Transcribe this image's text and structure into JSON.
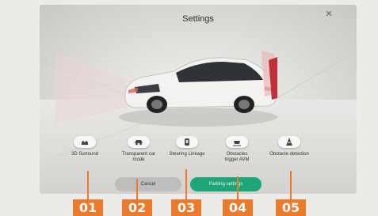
{
  "header": {
    "title": "Settings"
  },
  "close": {
    "glyph": "×"
  },
  "options": [
    {
      "label": "3D Surround",
      "icon": "car-top-icon"
    },
    {
      "label": "Transparent car mode",
      "icon": "car-side-icon"
    },
    {
      "label": "Steering Linkage",
      "icon": "steering-car-icon"
    },
    {
      "label": "Obstacles trigger AVM",
      "icon": "obstacle-car-icon"
    },
    {
      "label": "Obstacle detection",
      "icon": "cone-icon"
    }
  ],
  "buttons": {
    "cancel": "Cancel",
    "parking": "Parking settings"
  },
  "tags": [
    "01",
    "02",
    "03",
    "04",
    "05"
  ],
  "colors": {
    "accent": "#1ea57a",
    "tag": "#ec7a2c",
    "obstacle": "#c0303a"
  }
}
